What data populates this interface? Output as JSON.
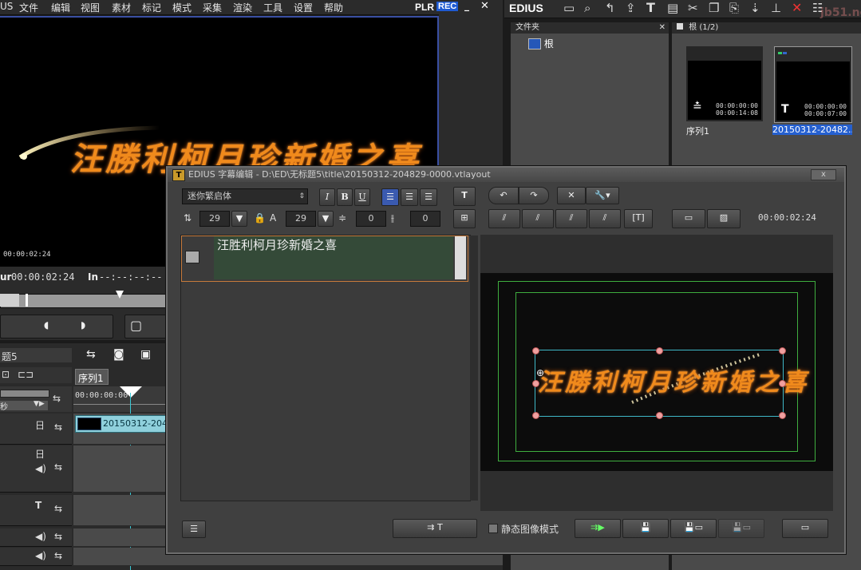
{
  "menu": {
    "app_tail": "US",
    "items": [
      "文件",
      "编辑",
      "视图",
      "素材",
      "标记",
      "模式",
      "采集",
      "渲染",
      "工具",
      "设置",
      "帮助"
    ],
    "plr": "PLR",
    "rec": "REC"
  },
  "player": {
    "title_text": "汪勝利柯月珍新婚之喜",
    "small_tc": "00:00:02:24",
    "cur_label": "ur",
    "cur_tc": "00:00:02:24",
    "in_label": "In",
    "in_tc": "--:--:--:--"
  },
  "timeline": {
    "project_name": "题5",
    "seq_tab": "序列1",
    "ruler_tc": "00:00:00:00",
    "unit": "秒",
    "clip_name": "20150312-204",
    "track_glyphs": [
      "日",
      "日",
      "T"
    ]
  },
  "right_toolbar": {
    "brand": "EDIUS",
    "watermark": "jb51.net"
  },
  "folder_panel": {
    "header": "文件夹",
    "root": "根"
  },
  "bin_panel": {
    "header": "根 (1/2)",
    "clips": [
      {
        "name": "序列1",
        "tc1": "00:00:00:00",
        "tc2": "00:00:14:08"
      },
      {
        "name": "20150312-20482...",
        "tc1": "00:00:00:00",
        "tc2": "00:00:07:00"
      }
    ]
  },
  "dialog": {
    "title": "EDIUS 字幕编辑 - D:\\ED\\无标题5\\title\\20150312-204829-0000.vtlayout",
    "close": "x",
    "font_name": "迷你繁启体",
    "bold": "B",
    "italic": "I",
    "underline": "U",
    "font_size": "29",
    "height_value": "29",
    "spacing1": "0",
    "spacing2": "0",
    "timecode": "00:00:02:24",
    "object_text": "汪胜利柯月珍新婚之喜",
    "static_mode_label": "静态图像模式"
  },
  "colors": {
    "accent": "#3a4fa3",
    "title_orange": "#f08a1c",
    "object_bg": "#344a38",
    "safe_green": "#3fae3f",
    "selection_cyan": "#3fb8c8"
  }
}
